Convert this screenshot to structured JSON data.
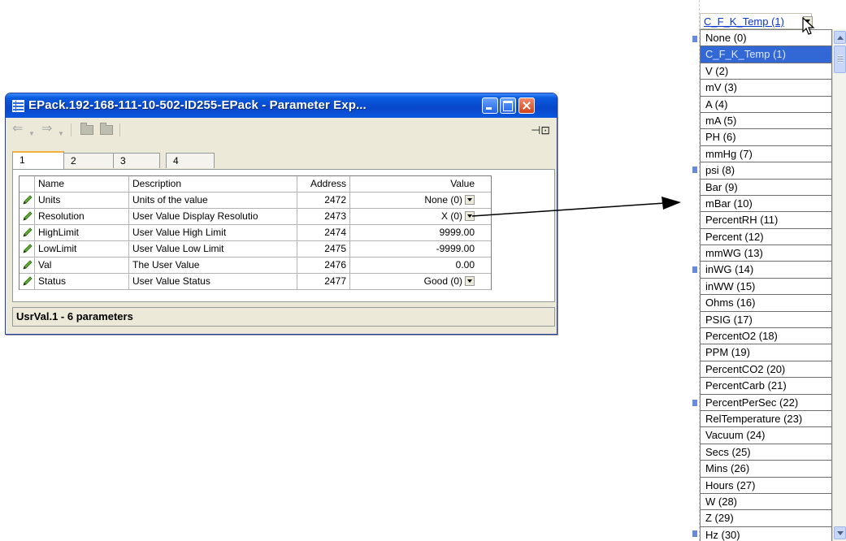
{
  "window": {
    "title": "EPack.192-168-111-10-502-ID255-EPack - Parameter Exp...",
    "tabs": [
      "1",
      "2",
      "3",
      "4"
    ],
    "active_tab": "1",
    "status": "UsrVal.1  -  6 parameters"
  },
  "table": {
    "headers": [
      "Name",
      "Description",
      "Address",
      "Value"
    ],
    "rows": [
      {
        "name": "Units",
        "description": "Units of the value",
        "address": "2472",
        "value": "None (0)",
        "dropdown": true
      },
      {
        "name": "Resolution",
        "description": "User Value Display Resolutio",
        "address": "2473",
        "value": "X (0)",
        "dropdown": true
      },
      {
        "name": "HighLimit",
        "description": "User Value High Limit",
        "address": "2474",
        "value": "9999.00",
        "dropdown": false
      },
      {
        "name": "LowLimit",
        "description": "User Value Low Limit",
        "address": "2475",
        "value": "-9999.00",
        "dropdown": false
      },
      {
        "name": "Val",
        "description": "The User Value",
        "address": "2476",
        "value": "0.00",
        "dropdown": false
      },
      {
        "name": "Status",
        "description": "User Value Status",
        "address": "2477",
        "value": "Good (0)",
        "dropdown": true
      }
    ]
  },
  "dropdown": {
    "current": "C_F_K_Temp (1)",
    "selected_index": 1,
    "options": [
      "None (0)",
      "C_F_K_Temp (1)",
      "V (2)",
      "mV (3)",
      "A (4)",
      "mA (5)",
      "PH (6)",
      "mmHg (7)",
      "psi (8)",
      "Bar (9)",
      "mBar (10)",
      "PercentRH (11)",
      "Percent (12)",
      "mmWG (13)",
      "inWG (14)",
      "inWW (15)",
      "Ohms (16)",
      "PSIG (17)",
      "PercentO2 (18)",
      "PPM (19)",
      "PercentCO2 (20)",
      "PercentCarb (21)",
      "PercentPerSec (22)",
      "RelTemperature (23)",
      "Vacuum (24)",
      "Secs (25)",
      "Mins (26)",
      "Hours (27)",
      "W (28)",
      "Z (29)",
      "Hz (30)"
    ]
  },
  "colors": {
    "titlebar": "#0a5bdf",
    "selection": "#3267d6",
    "window_bg": "#ece9d8",
    "active_tab_accent": "#f4b13d"
  }
}
